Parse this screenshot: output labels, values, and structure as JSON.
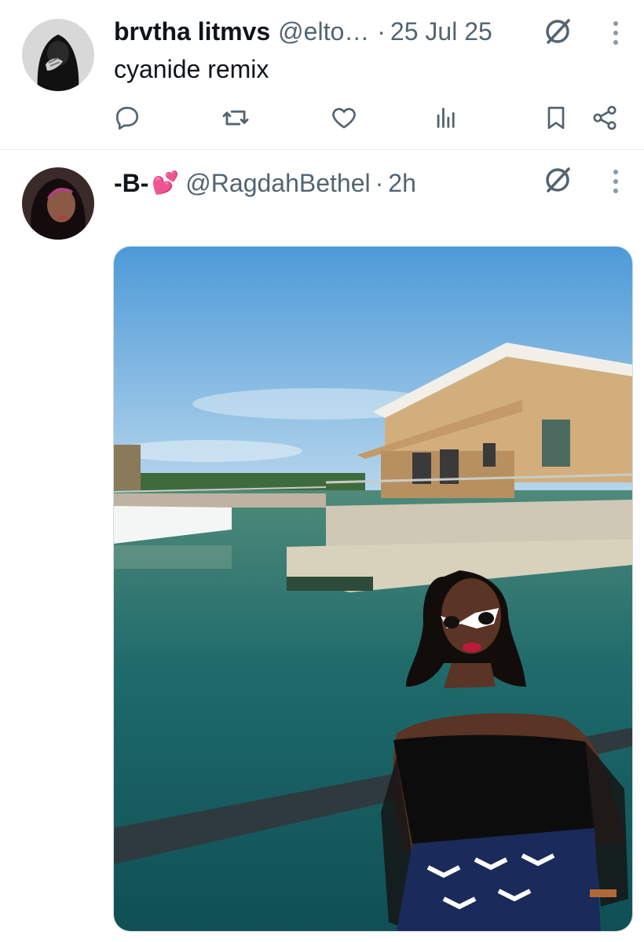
{
  "tweets": [
    {
      "name": "brvtha litmvs",
      "handle": "@elto…",
      "separator": "·",
      "time": "25 Jul 25",
      "text": "cyanide remix",
      "avatar_icon": "hooded-figure-avatar",
      "actions": [
        {
          "icon": "reply-icon",
          "label": ""
        },
        {
          "icon": "retweet-icon",
          "label": ""
        },
        {
          "icon": "like-icon",
          "label": ""
        },
        {
          "icon": "views-icon",
          "label": ""
        },
        {
          "icon": "bookmark-icon",
          "label": ""
        },
        {
          "icon": "share-icon",
          "label": ""
        }
      ]
    },
    {
      "name": "-B-",
      "name_emoji": "💕",
      "handle": "@RagdahBethel",
      "separator": "·",
      "time": "2h",
      "avatar_icon": "woman-portrait-avatar",
      "media": {
        "type": "photo",
        "subject": "woman-in-sunglasses-by-lake-with-wooden-cabin"
      }
    }
  ],
  "colors": {
    "text_primary": "#0f1419",
    "text_secondary": "#536471",
    "icon": "#536471",
    "divider": "#e6ecf0",
    "sky": "#5fa6dc",
    "water": "#1f6b6b"
  }
}
